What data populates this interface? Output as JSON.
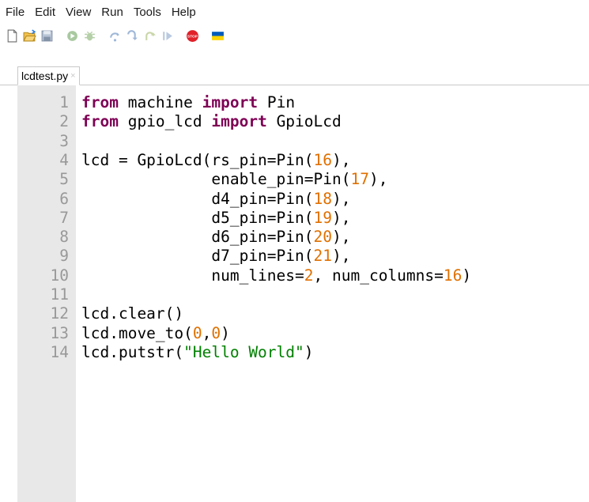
{
  "menu": {
    "items": [
      "File",
      "Edit",
      "View",
      "Run",
      "Tools",
      "Help"
    ]
  },
  "toolbar": {
    "icons": [
      "new-file-icon",
      "open-folder-icon",
      "save-icon",
      "run-icon",
      "debug-icon",
      "step-over-icon",
      "step-into-icon",
      "step-out-icon",
      "resume-icon",
      "stop-icon",
      "ukraine-flag-icon"
    ],
    "colors": {
      "stop": "#e0202a",
      "flag_blue": "#005bbb",
      "flag_yellow": "#ffd500"
    }
  },
  "tab": {
    "title": "lcdtest.py",
    "close_glyph": "×"
  },
  "editor": {
    "lines": [
      {
        "n": "1",
        "tokens": [
          [
            "kw",
            "from"
          ],
          [
            "p",
            " machine "
          ],
          [
            "kw",
            "import"
          ],
          [
            "p",
            " Pin"
          ]
        ]
      },
      {
        "n": "2",
        "tokens": [
          [
            "kw",
            "from"
          ],
          [
            "p",
            " gpio_lcd "
          ],
          [
            "kw",
            "import"
          ],
          [
            "p",
            " GpioLcd"
          ]
        ]
      },
      {
        "n": "3",
        "tokens": []
      },
      {
        "n": "4",
        "tokens": [
          [
            "p",
            "lcd = GpioLcd(rs_pin=Pin("
          ],
          [
            "num",
            "16"
          ],
          [
            "p",
            "),"
          ]
        ]
      },
      {
        "n": "5",
        "tokens": [
          [
            "p",
            "              enable_pin=Pin("
          ],
          [
            "num",
            "17"
          ],
          [
            "p",
            "),"
          ]
        ]
      },
      {
        "n": "6",
        "tokens": [
          [
            "p",
            "              d4_pin=Pin("
          ],
          [
            "num",
            "18"
          ],
          [
            "p",
            "),"
          ]
        ]
      },
      {
        "n": "7",
        "tokens": [
          [
            "p",
            "              d5_pin=Pin("
          ],
          [
            "num",
            "19"
          ],
          [
            "p",
            "),"
          ]
        ]
      },
      {
        "n": "8",
        "tokens": [
          [
            "p",
            "              d6_pin=Pin("
          ],
          [
            "num",
            "20"
          ],
          [
            "p",
            "),"
          ]
        ]
      },
      {
        "n": "9",
        "tokens": [
          [
            "p",
            "              d7_pin=Pin("
          ],
          [
            "num",
            "21"
          ],
          [
            "p",
            "),"
          ]
        ]
      },
      {
        "n": "10",
        "tokens": [
          [
            "p",
            "              num_lines="
          ],
          [
            "num",
            "2"
          ],
          [
            "p",
            ", num_columns="
          ],
          [
            "num",
            "16"
          ],
          [
            "p",
            ")"
          ]
        ]
      },
      {
        "n": "11",
        "tokens": []
      },
      {
        "n": "12",
        "tokens": [
          [
            "p",
            "lcd.clear()"
          ]
        ]
      },
      {
        "n": "13",
        "tokens": [
          [
            "p",
            "lcd.move_to("
          ],
          [
            "num",
            "0"
          ],
          [
            "p",
            ","
          ],
          [
            "num",
            "0"
          ],
          [
            "p",
            ")"
          ]
        ]
      },
      {
        "n": "14",
        "tokens": [
          [
            "p",
            "lcd.putstr("
          ],
          [
            "str",
            "\"Hello World\""
          ],
          [
            "p",
            ")"
          ]
        ]
      }
    ],
    "colors": {
      "keyword": "#7f0055",
      "number": "#e07000",
      "string": "#008000",
      "gutter_bg": "#e8e8e8",
      "line_number": "#999999"
    }
  }
}
